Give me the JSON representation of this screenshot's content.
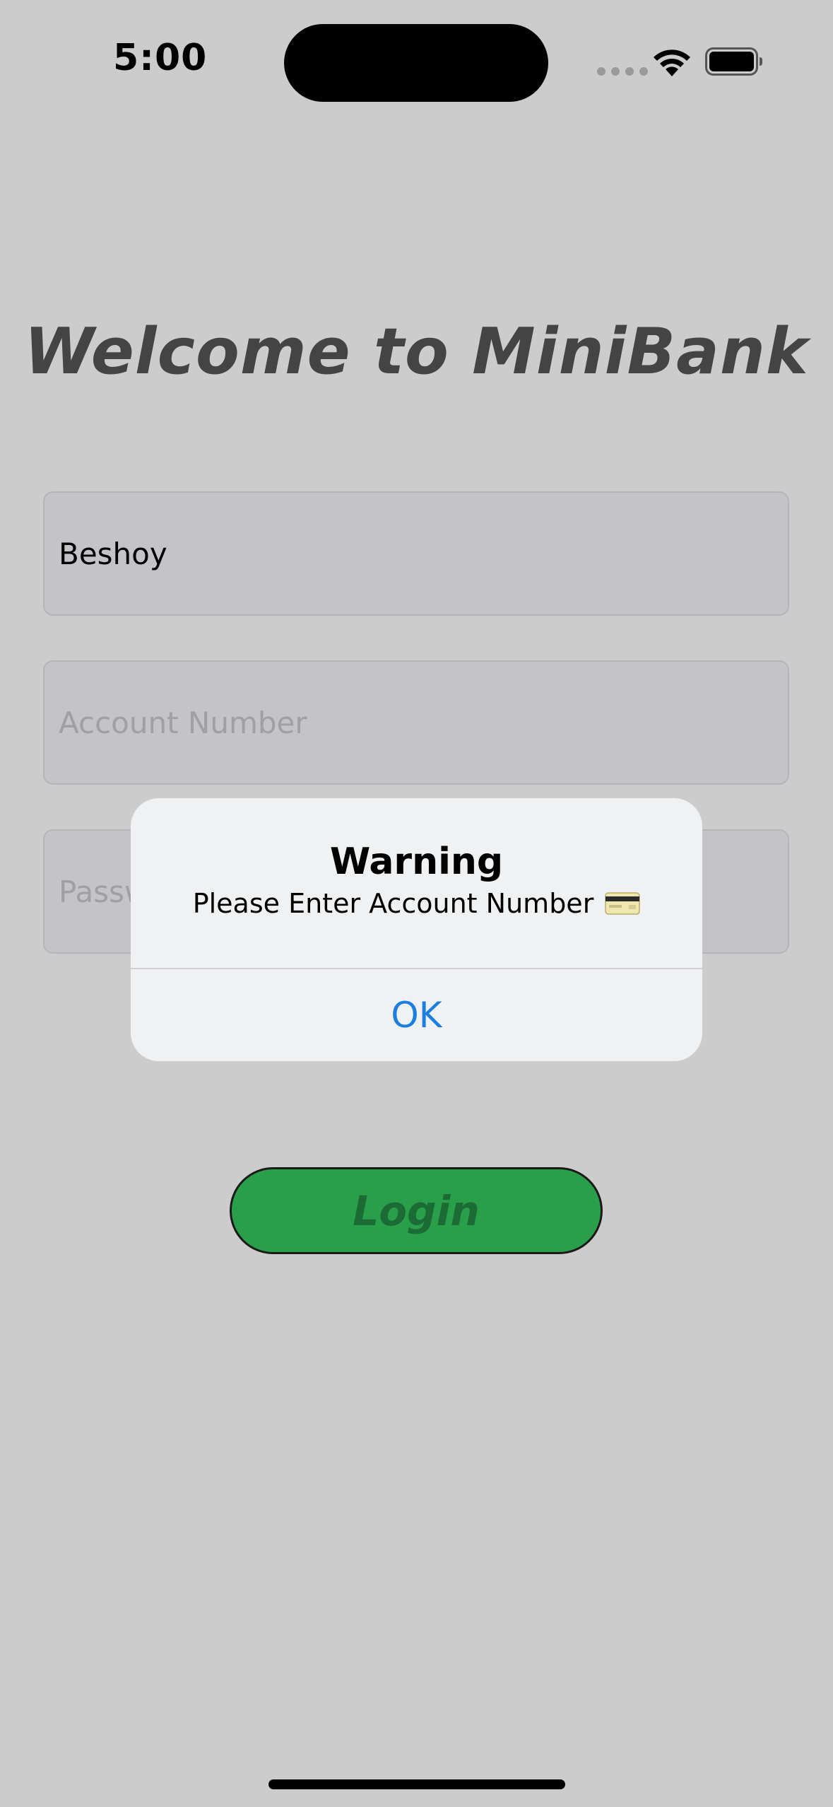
{
  "status_bar": {
    "time": "5:00",
    "icons": [
      "signal-dots-icon",
      "wifi-icon",
      "battery-icon"
    ]
  },
  "title": "Welcome to MiniBank",
  "fields": {
    "username_value": "Beshoy",
    "account_placeholder": "Account Number",
    "password_placeholder": "Password"
  },
  "alert": {
    "title": "Warning",
    "message": "Please Enter Account Number",
    "message_icon": "credit-card-icon",
    "ok_label": "OK"
  },
  "login_button": {
    "label": "Login"
  },
  "colors": {
    "background": "#cccccc",
    "title": "#444444",
    "login_green": "#2a9f4a",
    "alert_link": "#1a7fe0"
  }
}
